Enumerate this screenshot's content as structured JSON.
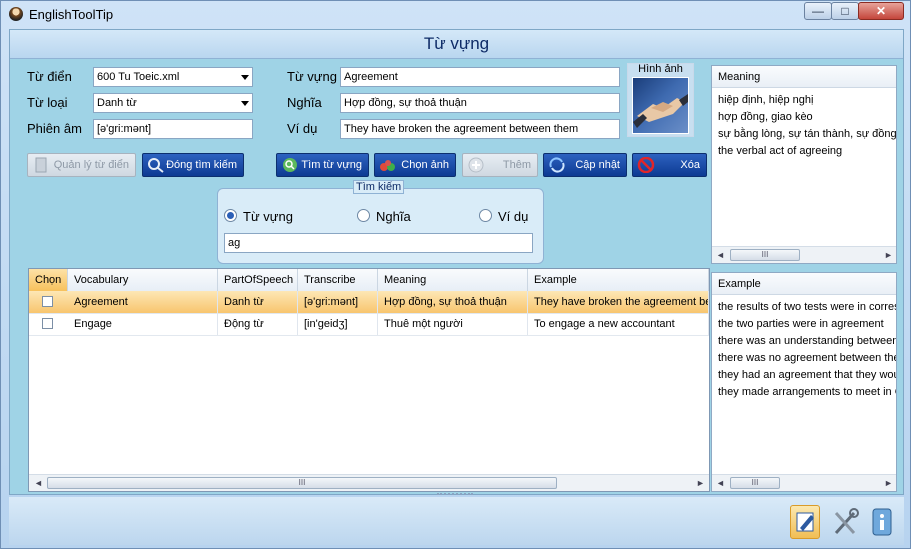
{
  "window": {
    "title": "EnglishToolTip",
    "controls": [
      "—",
      "□",
      "✕"
    ]
  },
  "header": {
    "title": "Từ vựng"
  },
  "form": {
    "dictionary_label": "Từ điển",
    "dictionary_value": "600 Tu Toeic.xml",
    "wordtype_label": "Từ loại",
    "wordtype_value": "Danh từ",
    "phonetic_label": "Phiên âm",
    "phonetic_value": "[ə'gri:mənt]",
    "word_label": "Từ vựng",
    "word_value": "Agreement",
    "meaning_label": "Nghĩa",
    "meaning_value": "Hợp đồng, sự thoả thuận",
    "example_label": "Ví dụ",
    "example_value": "They have broken the agreement between them",
    "image_label": "Hình ảnh"
  },
  "buttons": {
    "manage_dict": "Quản lý từ điển",
    "close_search": "Đóng tìm kiếm",
    "search_word": "Tìm từ vựng",
    "choose_image": "Chọn ảnh",
    "add": "Thêm",
    "update": "Cập nhật",
    "delete": "Xóa"
  },
  "search": {
    "group_title": "Tìm kiếm",
    "options": [
      "Từ vựng",
      "Nghĩa",
      "Ví dụ"
    ],
    "selected": 0,
    "query": "ag"
  },
  "table": {
    "columns": [
      "Chọn",
      "Vocabulary",
      "PartOfSpeech",
      "Transcribe",
      "Meaning",
      "Example"
    ],
    "rows": [
      {
        "vocabulary": "Agreement",
        "pos": "Danh từ",
        "transcribe": "[ə'gri:mənt]",
        "meaning": "Hợp đồng, sự thoả thuận",
        "example": "They have broken the agreement bet"
      },
      {
        "vocabulary": "Engage",
        "pos": "Động từ",
        "transcribe": "[in'geidʒ]",
        "meaning": "Thuê một người",
        "example": "To engage a new accountant"
      }
    ]
  },
  "meaning_panel": {
    "title": "Meaning",
    "lines": [
      "hiệp định, hiệp nghị",
      "hợp đồng, giao kèo",
      "sự bằng lòng, sự tán thành, sự đồng ý",
      "the verbal act of agreeing"
    ]
  },
  "example_panel": {
    "title": "Example",
    "lines": [
      "the results of two tests were in corresp",
      "the two parties were in agreement",
      "there was an understanding between",
      "there was no agreement between the",
      "they had an agreement that they wou",
      "they made arrangements to meet in Cl"
    ]
  },
  "scrollbar": {
    "grip": "III",
    "left": "◄",
    "right": "►"
  },
  "icons": {
    "app": "app-logo-icon",
    "tools": [
      "pen-icon",
      "wrench-tools-icon",
      "info-icon"
    ]
  },
  "colors": {
    "accent": "#0d3a92",
    "selection": "#f8c56e",
    "background": "#9fd3e6"
  }
}
